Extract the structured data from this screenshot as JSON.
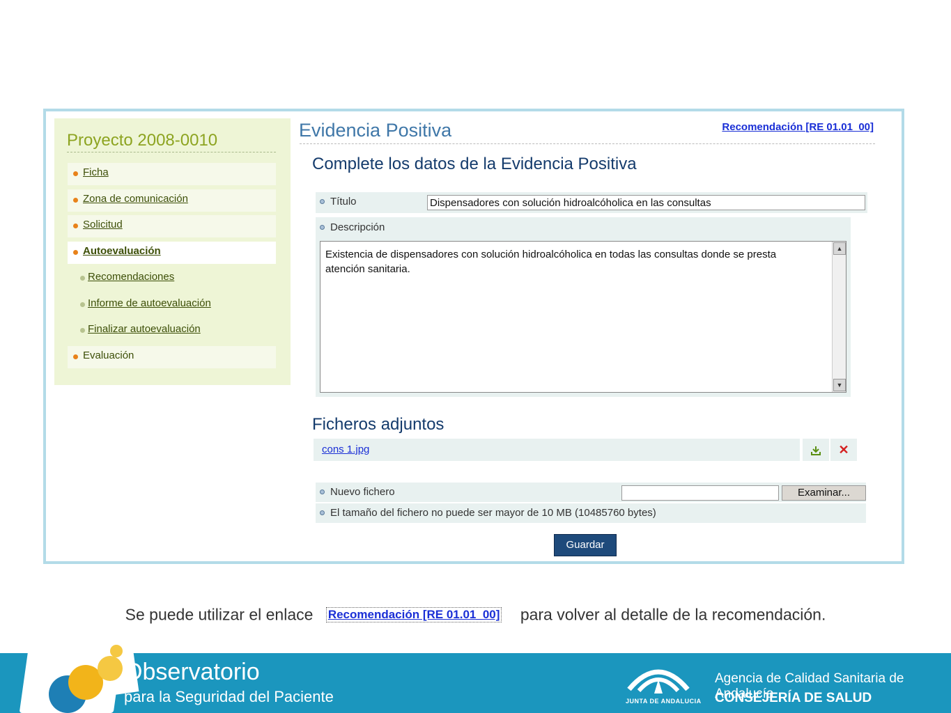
{
  "sidebar": {
    "project_title": "Proyecto 2008-0010",
    "items": [
      {
        "label": "Ficha"
      },
      {
        "label": "Zona de comunicación"
      },
      {
        "label": "Solicitud"
      },
      {
        "label": "Autoevaluación"
      },
      {
        "label": "Evaluación"
      }
    ],
    "sub_items": [
      {
        "label": "Recomendaciones"
      },
      {
        "label": "Informe de autoevaluación"
      },
      {
        "label": "Finalizar autoevaluación"
      }
    ]
  },
  "main": {
    "title": "Evidencia Positiva",
    "recommendation_link": "Recomendación [RE 01.01_00]",
    "subheading": "Complete los datos de la Evidencia Positiva",
    "titulo_label": "Título",
    "titulo_value": "Dispensadores con solución hidroalcóholica en las consultas",
    "descripcion_label": "Descripción",
    "descripcion_value": "Existencia de dispensadores con solución hidroalcóholica en todas las consultas donde se presta atención sanitaria.",
    "files_heading": "Ficheros adjuntos",
    "file_name": "cons 1.jpg",
    "nuevo_fichero_label": "Nuevo fichero",
    "examinar_label": "Examinar...",
    "size_note": "El tamaño del fichero no puede ser mayor de 10 MB (10485760 bytes)",
    "guardar_label": "Guardar"
  },
  "caption": {
    "before": "Se puede utilizar el enlace",
    "link": "Recomendación [RE 01.01_00]",
    "after": "para volver al detalle de la recomendación."
  },
  "footer": {
    "obs_title": "Observatorio",
    "obs_sub": "para la Seguridad del Paciente",
    "junta": "JUNTA DE ANDALUCIA",
    "agencia": "Agencia de Calidad Sanitaria de Andalucía",
    "consejeria": "CONSEJERÍA DE SALUD"
  },
  "icons": {
    "download": "download-icon",
    "delete": "delete-icon"
  },
  "colors": {
    "sidebar_bg": "#eef5d6",
    "link_blue": "#1a2fd6",
    "title_blue": "#3f77a8",
    "button_navy": "#1e4a7b",
    "footer_blue": "#1b96be",
    "frame_border": "#b3dbe8"
  }
}
